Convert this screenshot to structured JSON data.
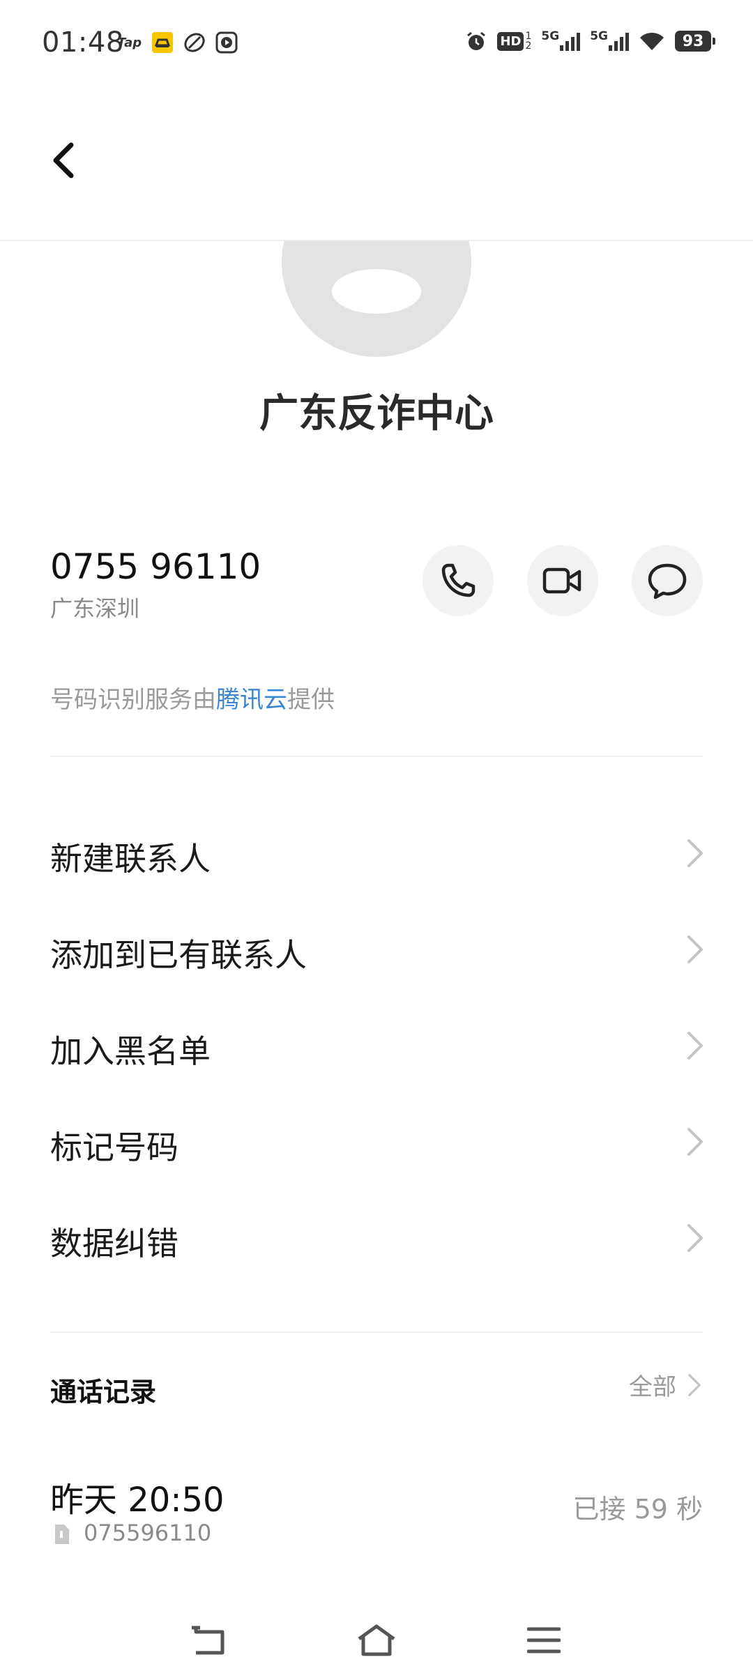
{
  "status_bar": {
    "time": "01:48",
    "left_icons": [
      "tap-icon",
      "car-app-icon",
      "leaf-app-icon",
      "play-app-icon"
    ],
    "tap_label": "Tap",
    "right_icons": [
      "alarm-icon",
      "hd-icon",
      "signal-5g-icon",
      "signal-5g-icon",
      "wifi-icon",
      "battery-icon"
    ],
    "hd_label": "HD",
    "signal_label": "5G",
    "battery": "93"
  },
  "header": {
    "back_icon": "chevron-left-icon"
  },
  "contact": {
    "name": "广东反诈中心",
    "number": "0755 96110",
    "location": "广东深圳"
  },
  "actions": {
    "call_icon": "phone-icon",
    "video_icon": "video-camera-icon",
    "message_icon": "message-bubble-icon"
  },
  "id_service": {
    "prefix": "号码识别服务由",
    "brand": "腾讯云",
    "suffix": "提供"
  },
  "menu": {
    "items": [
      {
        "label": "新建联系人"
      },
      {
        "label": "添加到已有联系人"
      },
      {
        "label": "加入黑名单"
      },
      {
        "label": "标记号码"
      },
      {
        "label": "数据纠错"
      }
    ]
  },
  "call_log": {
    "title": "通话记录",
    "all_label": "全部",
    "entries": [
      {
        "time": "昨天 20:50",
        "number": "075596110",
        "status": "已接 59 秒"
      }
    ]
  },
  "colors": {
    "brand_link": "#3a86d6",
    "muted_text": "#9a9a9a",
    "button_bg": "#f2f2f2"
  }
}
